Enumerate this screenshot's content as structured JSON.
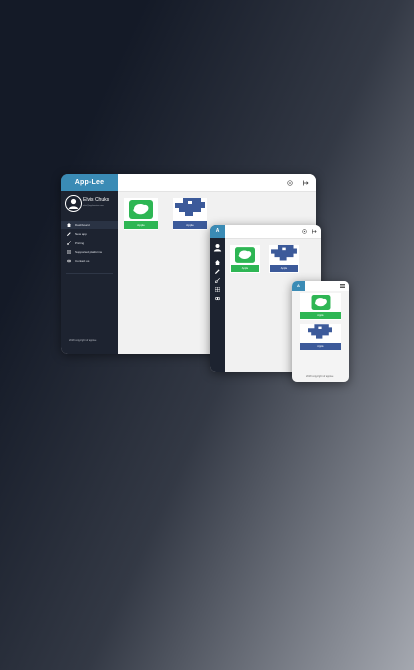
{
  "brand": {
    "name": "App-Lee",
    "short": "A"
  },
  "user": {
    "name": "Elvis Chuks",
    "email": "elvis@appleestore.com"
  },
  "sidebar": {
    "items": [
      {
        "label": "Dashboard",
        "icon": "home-icon",
        "active": true
      },
      {
        "label": "New app",
        "icon": "pencil-icon"
      },
      {
        "label": "Pricing",
        "icon": "key-icon"
      },
      {
        "label": "Supported platforms",
        "icon": "grid-icon"
      },
      {
        "label": "Contact us",
        "icon": "contacts-icon"
      }
    ]
  },
  "footer": {
    "copyright": "2018 copyright of applee"
  },
  "apps": [
    {
      "label": "Apple",
      "icon": "green-app-icon",
      "color": "#2eb654"
    },
    {
      "label": "Apple",
      "icon": "blue-app-icon",
      "color": "#3c5a9a"
    }
  ],
  "topbar": {
    "icons": [
      "settings-icon",
      "logout-icon"
    ]
  },
  "colors": {
    "accent": "#3a8bb5",
    "sidebar": "#1d2330",
    "green": "#2eb654",
    "blue": "#3c5a9a"
  }
}
